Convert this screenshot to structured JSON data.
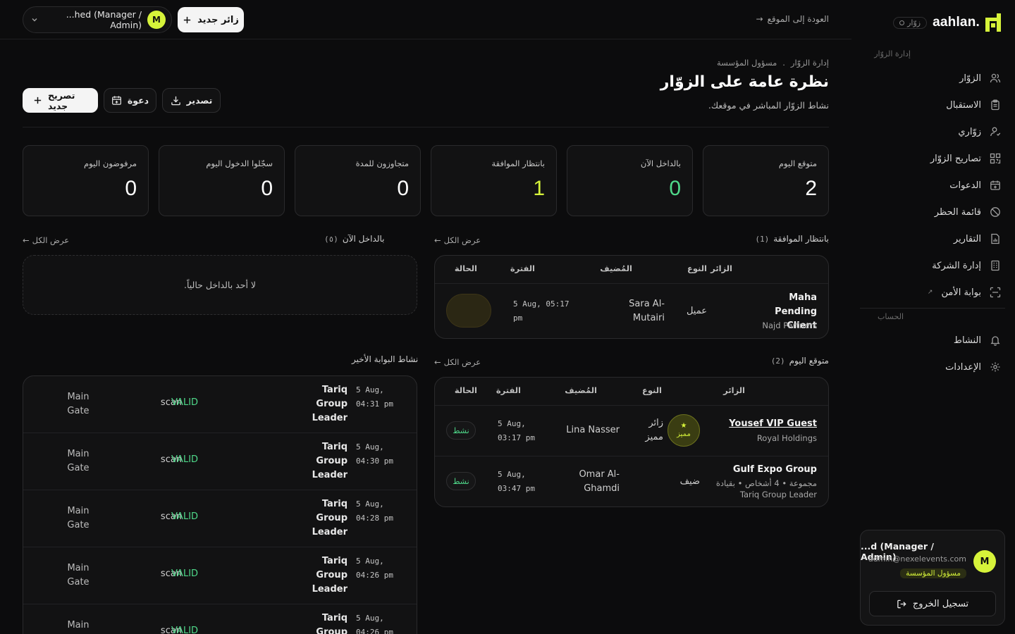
{
  "brand": {
    "name": ".aahlan",
    "tag": "زوّار"
  },
  "sidebar": {
    "section_main": "إدارة الزوّار",
    "items": [
      {
        "label": "الزوّار",
        "icon": "users-icon"
      },
      {
        "label": "الاستقبال",
        "icon": "clipboard-icon"
      },
      {
        "label": "زوّاري",
        "icon": "user-icon"
      },
      {
        "label": "تصاريح الزوّار",
        "icon": "qr-icon"
      },
      {
        "label": "الدعوات",
        "icon": "calendar-icon"
      },
      {
        "label": "قائمة الحظر",
        "icon": "ban-icon"
      },
      {
        "label": "التقارير",
        "icon": "report-icon"
      },
      {
        "label": "إدارة الشركة",
        "icon": "building-icon"
      },
      {
        "label": "بوابة الأمن",
        "icon": "scan-icon",
        "external": "↗"
      }
    ],
    "section_account": "الحساب",
    "account_items": [
      {
        "label": "النشاط",
        "icon": "bell-icon"
      },
      {
        "label": "الإعدادات",
        "icon": "gear-icon"
      }
    ]
  },
  "account": {
    "avatar": "M",
    "name": "...d (Manager / Admin)",
    "email": "admin@nexelevents.com",
    "role": "مسؤول المؤسسة",
    "logout": "تسجيل الخروج"
  },
  "topbar": {
    "back": "العودة إلى الموقع",
    "back_arrow": "→",
    "new_visitor": "زائر جديد",
    "user_avatar": "M",
    "user_name": "...hed (Manager / Admin)"
  },
  "header": {
    "breadcrumb_1": "إدارة الزوّار",
    "breadcrumb_sep": ".",
    "breadcrumb_2": "مسؤول المؤسسة",
    "title": "نظرة عامة على الزوّار",
    "subtitle": "نشاط الزوّار المباشر في موقعك."
  },
  "actions": {
    "new_pass": "تصريح جديد",
    "invite": "دعوة",
    "export": "تصدير"
  },
  "stats": [
    {
      "label": "متوقع اليوم",
      "value": "2",
      "tone": "white"
    },
    {
      "label": "بالداخل الآن",
      "value": "0",
      "tone": "green"
    },
    {
      "label": "بانتظار الموافقة",
      "value": "1",
      "tone": "lime"
    },
    {
      "label": "متجاوزون للمدة",
      "value": "0",
      "tone": "white"
    },
    {
      "label": "سجّلوا الدخول اليوم",
      "value": "0",
      "tone": "white"
    },
    {
      "label": "مرفوضون اليوم",
      "value": "0",
      "tone": "white"
    }
  ],
  "view_all": "عرض الكل",
  "view_all_arrow": "←",
  "pending": {
    "title": "بانتظار الموافقة",
    "count": "(1)",
    "headers": {
      "visitor": "الزائر",
      "type": "النوع",
      "host": "المُضيف",
      "period": "الفترة",
      "status": "الحالة"
    },
    "rows": [
      {
        "name": "Maha Pending Client",
        "company": "Najd Partners",
        "type": "عميل",
        "host": "Sara Al-Mutairi",
        "time": "5 Aug, 05:17 pm"
      }
    ]
  },
  "inside": {
    "title": "بالداخل الآن",
    "count": "(٥)",
    "empty": "لا أحد بالداخل حالياً."
  },
  "expected": {
    "title": "متوقع اليوم",
    "count": "(2)",
    "headers": {
      "visitor": "الزائر",
      "type": "النوع",
      "host": "المُضيف",
      "period": "الفترة",
      "status": "الحالة"
    },
    "rows": [
      {
        "name": "Yousef VIP Guest",
        "company": "Royal Holdings",
        "badge_star": "★",
        "badge_text": "مميز",
        "type": "زائر مميز",
        "host": "Lina Nasser",
        "time": "5 Aug, 03:17 pm",
        "status": "نشط"
      },
      {
        "name": "Gulf Expo Group",
        "company": "مجموعة • 4 أشخاص • بقيادة",
        "leader": "Tariq Group Leader",
        "type": "ضيف",
        "host": "Omar Al-Ghamdi",
        "time": "5 Aug, 03:47 pm",
        "status": "نشط"
      }
    ]
  },
  "gate": {
    "title": "نشاط البوابة الأخير",
    "rows": [
      {
        "who": "Tariq Group Leader",
        "time": "5 Aug, 04:31 pm",
        "method": "scan",
        "result": "VALID",
        "gate": "Main Gate"
      },
      {
        "who": "Tariq Group Leader",
        "time": "5 Aug, 04:30 pm",
        "method": "scan",
        "result": "VALID",
        "gate": "Main Gate"
      },
      {
        "who": "Tariq Group Leader",
        "time": "5 Aug, 04:28 pm",
        "method": "scan",
        "result": "VALID",
        "gate": "Main Gate"
      },
      {
        "who": "Tariq Group Leader",
        "time": "5 Aug, 04:26 pm",
        "method": "scan",
        "result": "VALID",
        "gate": "Main Gate"
      },
      {
        "who": "Tariq Group Leader",
        "time": "5 Aug, 04:26 pm",
        "method": "scan",
        "result": "VALID",
        "gate": "Main Gate"
      }
    ]
  },
  "colors": {
    "accent": "#d6f33a",
    "success": "#4fd98a",
    "background": "#0c0c0d",
    "card": "#121213"
  }
}
